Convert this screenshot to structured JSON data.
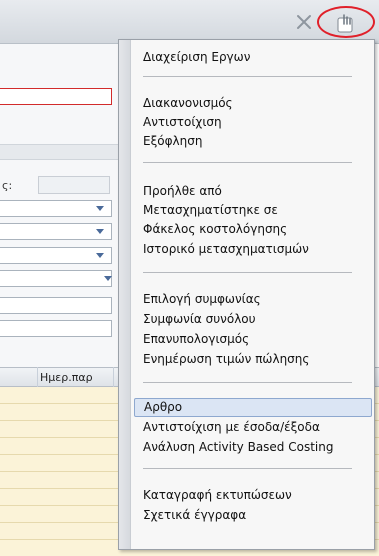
{
  "background": {
    "partial_label": "ς:",
    "grid_header_label": "Ημερ.παρ"
  },
  "menu": {
    "groups": [
      [
        "Διαχείριση Εργων"
      ],
      [
        "Διακανονισμός",
        "Αντιστοίχιση",
        "Εξόφληση"
      ],
      [
        "Προήλθε από",
        "Μετασχηματίστηκε σε",
        "Φάκελος κοστολόγησης",
        "Ιστορικό μετασχηματισμών"
      ],
      [
        "Επιλογή συμφωνίας",
        "Συμφωνία συνόλου",
        "Επανυπολογισμός",
        "Ενημέρωση τιμών πώλησης"
      ],
      [
        "Αρθρο",
        "Αντιστοίχιση με έσοδα/έξοδα",
        "Ανάλυση Activity Based Costing"
      ],
      [
        "Καταγραφή εκτυπώσεων",
        "Σχετικά έγγραφα"
      ]
    ],
    "highlighted": "Αρθρο"
  },
  "icons": {
    "close": "close-x-icon",
    "toolbar_action": "hand-pointer-icon"
  },
  "colors": {
    "highlight_bg": "#dbe5f4",
    "highlight_border": "#8ea8cf",
    "annotation_red": "#e0202a",
    "grid_row": "#fbf3d8"
  }
}
